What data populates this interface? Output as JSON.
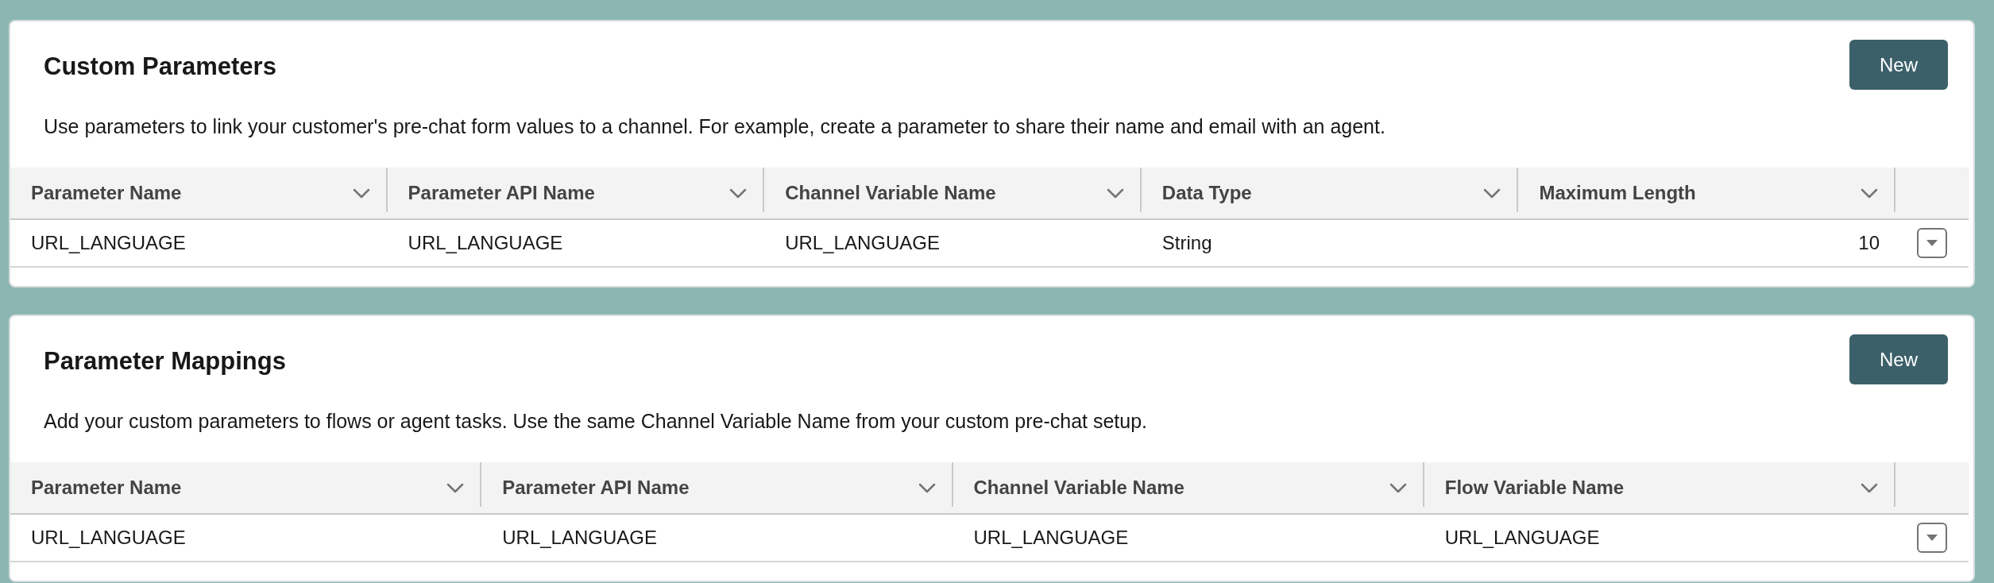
{
  "sections": [
    {
      "title": "Custom Parameters",
      "description": "Use parameters to link your customer's pre-chat form values to a channel. For example, create a parameter to share their name and email with an agent.",
      "button": "New",
      "columns": [
        {
          "label": "Parameter Name",
          "kind": "text"
        },
        {
          "label": "Parameter API Name",
          "kind": "text"
        },
        {
          "label": "Channel Variable Name",
          "kind": "text"
        },
        {
          "label": "Data Type",
          "kind": "text"
        },
        {
          "label": "Maximum Length",
          "kind": "number"
        }
      ],
      "rows": [
        {
          "cells": [
            "URL_LANGUAGE",
            "URL_LANGUAGE",
            "URL_LANGUAGE",
            "String",
            "10"
          ]
        }
      ]
    },
    {
      "title": "Parameter Mappings",
      "description": "Add your custom parameters to flows or agent tasks. Use the same Channel Variable Name from your custom pre-chat setup.",
      "button": "New",
      "columns": [
        {
          "label": "Parameter Name",
          "kind": "text"
        },
        {
          "label": "Parameter API Name",
          "kind": "text"
        },
        {
          "label": "Channel Variable Name",
          "kind": "text"
        },
        {
          "label": "Flow Variable Name",
          "kind": "text"
        }
      ],
      "rows": [
        {
          "cells": [
            "URL_LANGUAGE",
            "URL_LANGUAGE",
            "URL_LANGUAGE",
            "URL_LANGUAGE"
          ]
        }
      ]
    }
  ]
}
